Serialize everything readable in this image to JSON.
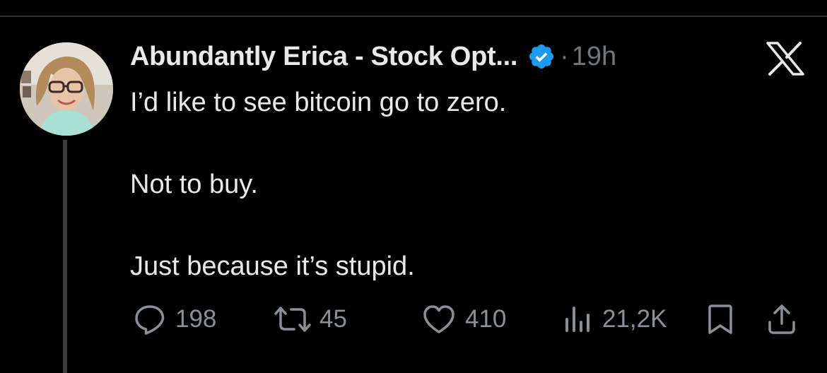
{
  "tweet": {
    "author_name": "Abundantly Erica - Stock Opt...",
    "separator": "·",
    "timestamp": "19h",
    "lines": [
      "I’d like to see bitcoin go to zero.",
      "",
      "Not to buy.",
      "",
      "Just because it’s stupid."
    ]
  },
  "actions": {
    "replies": "198",
    "reposts": "45",
    "likes": "410",
    "views": "21,2K"
  },
  "colors": {
    "background": "#000000",
    "primary_text": "#e7e9ea",
    "secondary_text": "#71767b",
    "verified_badge": "#1d9bf0"
  },
  "icons": {
    "verified": "verified-badge-icon",
    "brand": "x-logo-icon",
    "reply": "reply-icon",
    "repost": "repost-icon",
    "like": "heart-icon",
    "views": "views-chart-icon",
    "bookmark": "bookmark-icon",
    "share": "share-icon"
  }
}
